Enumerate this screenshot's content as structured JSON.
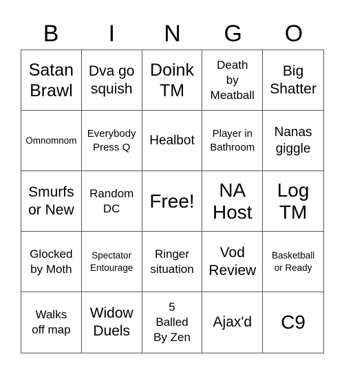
{
  "header": {
    "letters": [
      "B",
      "I",
      "N",
      "G",
      "O"
    ]
  },
  "cells": [
    {
      "text": "Satan\nBrawl",
      "size": "s26"
    },
    {
      "text": "Dva go\nsquish",
      "size": "s22"
    },
    {
      "text": "Doink\nTM",
      "size": "s26"
    },
    {
      "text": "Death\nby\nMeatball",
      "size": "s18"
    },
    {
      "text": "Big\nShatter",
      "size": "s22"
    },
    {
      "text": "Omnomnom",
      "size": "s14"
    },
    {
      "text": "Everybody\nPress Q",
      "size": "s16"
    },
    {
      "text": "Healbot",
      "size": "s20"
    },
    {
      "text": "Player in\nBathroom",
      "size": "s16"
    },
    {
      "text": "Nanas\ngiggle",
      "size": "s20"
    },
    {
      "text": "Smurfs\nor New",
      "size": "s22"
    },
    {
      "text": "Random\nDC",
      "size": "s18"
    },
    {
      "text": "Free!",
      "size": "s30"
    },
    {
      "text": "NA\nHost",
      "size": "s30"
    },
    {
      "text": "Log\nTM",
      "size": "s30"
    },
    {
      "text": "Glocked\nby Moth",
      "size": "s18"
    },
    {
      "text": "Spectator\nEntourage",
      "size": "s14"
    },
    {
      "text": "Ringer\nsituation",
      "size": "s18"
    },
    {
      "text": "Vod\nReview",
      "size": "s22"
    },
    {
      "text": "Basketball\nor Ready",
      "size": "s14"
    },
    {
      "text": "Walks\noff map",
      "size": "s18"
    },
    {
      "text": "Widow\nDuels",
      "size": "s22"
    },
    {
      "text": "5\nBalled\nBy Zen",
      "size": "s18"
    },
    {
      "text": "Ajax'd",
      "size": "s22"
    },
    {
      "text": "C9",
      "size": "s30"
    }
  ]
}
